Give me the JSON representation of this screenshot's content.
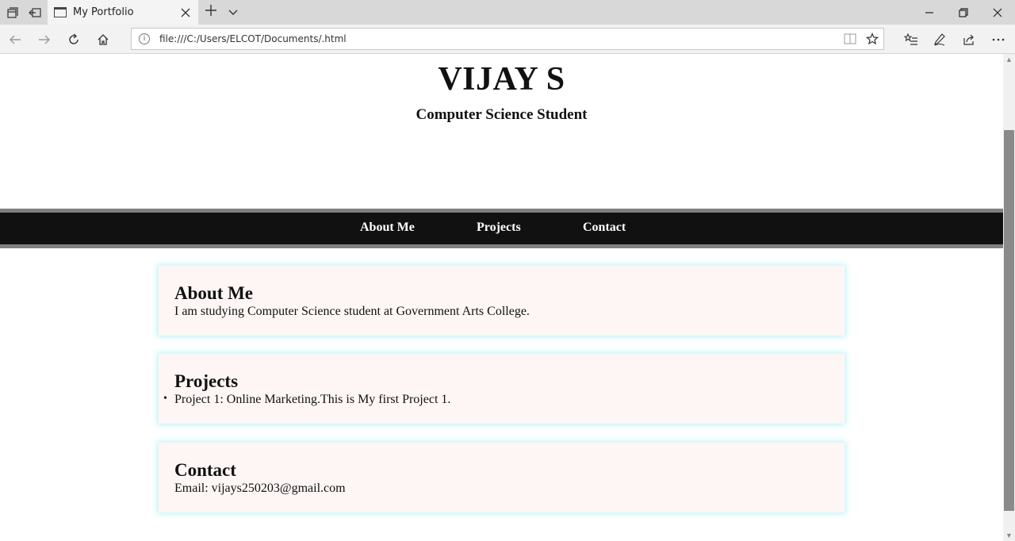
{
  "browser": {
    "tab": {
      "title": "My Portfolio"
    },
    "address": {
      "url": "file:///C:/Users/ELCOT/Documents/.html"
    },
    "icons": {
      "tab_manager": "tab-manager-icon",
      "set_aside": "set-aside-tabs-icon",
      "page": "page-icon",
      "close_tab": "close-icon",
      "new_tab": "plus-icon",
      "tab_list": "chevron-down-icon",
      "minimize": "minimize-icon",
      "restore": "restore-icon",
      "close_window": "close-icon",
      "back": "back-arrow-icon",
      "forward": "forward-arrow-icon",
      "refresh": "refresh-icon",
      "home": "home-icon",
      "info": "info-icon",
      "reading_view": "reading-view-icon",
      "favorite": "star-icon",
      "favorites_hub": "favorites-list-icon",
      "notes": "pen-icon",
      "share": "share-icon",
      "more": "more-icon"
    },
    "colors": {
      "tabbar": "#d8d8d8",
      "toolbar": "#f2f2f2",
      "scroll_thumb": "#8a8a8a"
    }
  },
  "page": {
    "header": {
      "name": "VIJAY S",
      "tagline": "Computer Science Student"
    },
    "nav": {
      "links": [
        "About Me",
        "Projects",
        "Contact"
      ]
    },
    "sections": {
      "about": {
        "title": "About Me",
        "text": "I am studying Computer Science student at Government Arts College."
      },
      "projects": {
        "title": "Projects",
        "items": [
          "Project 1: Online Marketing.This is My first Project 1."
        ]
      },
      "contact": {
        "title": "Contact",
        "email": "Email: vijays250203@gmail.com"
      }
    },
    "colors": {
      "nav_bg": "#111111",
      "nav_border": "#808080",
      "card_bg": "#fdf6f5",
      "card_glow": "#bff4f8"
    }
  }
}
